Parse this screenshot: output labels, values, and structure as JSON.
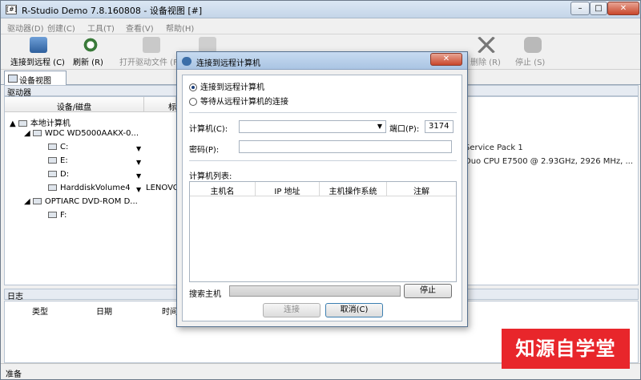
{
  "window": {
    "title": "R-Studio Demo 7.8.160808 - 设备视图 [#]",
    "app_icon": "[#]"
  },
  "menu": [
    "驱动器(D)",
    "创建(C)",
    "工具(T)",
    "查看(V)",
    "帮助(H)"
  ],
  "toolbar": {
    "items": [
      {
        "label": "连接到远程 (C)",
        "icon": "connect-remote-icon"
      },
      {
        "label": "刷新 (R)",
        "icon": "refresh-icon"
      },
      {
        "label": "打开驱动文件 (F)",
        "icon": "open-drive-file-icon"
      },
      {
        "label": "删除 (R)",
        "icon": "delete-icon"
      },
      {
        "label": "停止 (S)",
        "icon": "stop-icon"
      }
    ]
  },
  "tab": {
    "label": "设备视图"
  },
  "devices_panel": {
    "title": "驱动器",
    "columns": [
      "设备/磁盘",
      "标"
    ],
    "tree": [
      {
        "label": "本地计算机",
        "level": 0
      },
      {
        "label": "WDC WD5000AAKX-0...",
        "level": 1
      },
      {
        "label": "C:",
        "level": 2
      },
      {
        "label": "E:",
        "level": 2
      },
      {
        "label": "D:",
        "level": 2
      },
      {
        "label": "HarddiskVolume4",
        "level": 2,
        "extra": "LENOVO"
      },
      {
        "label": "OPTIARC DVD-ROM D...",
        "level": 1
      },
      {
        "label": "F:",
        "level": 2
      }
    ],
    "info_lines": [
      "Service Pack 1",
      "Duo CPU      E7500  @ 2.93GHz, 2926 MHz, ..."
    ]
  },
  "log_panel": {
    "title": "日志",
    "columns": [
      "类型",
      "日期",
      "时间"
    ]
  },
  "status": {
    "text": "准备"
  },
  "watermark": {
    "text": "知源自学堂"
  },
  "dialog": {
    "title": "连接到远程计算机",
    "close_label": "✕",
    "radio_connect": "连接到远程计算机",
    "radio_wait": "等待从远程计算机的连接",
    "computer_label": "计算机(C):",
    "computer_value": "",
    "port_label": "端口(P):",
    "port_value": "3174",
    "password_label": "密码(P):",
    "password_value": "",
    "list_label": "计算机列表:",
    "list_columns": [
      "主机名",
      "IP 地址",
      "主机操作系统",
      "注解"
    ],
    "search_label": "搜索主机",
    "stop_button": "停止",
    "connect_button": "连接",
    "cancel_button": "取消(C)"
  }
}
